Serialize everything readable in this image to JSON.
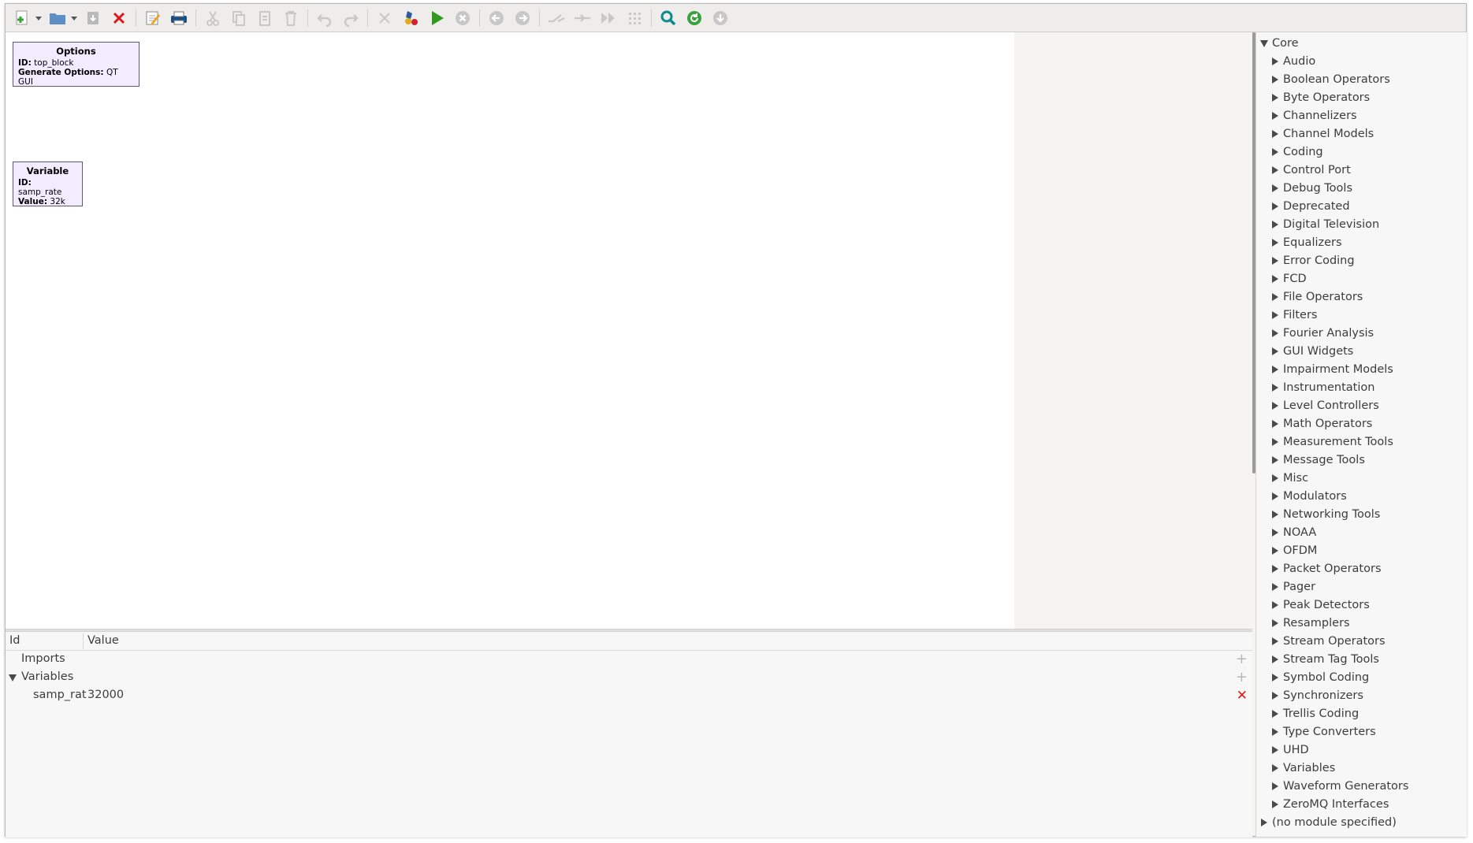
{
  "toolbar": {
    "buttons": [
      {
        "name": "new-button",
        "icon": "new-document-icon"
      },
      {
        "name": "new-dropdown",
        "icon": "chevron-down-icon"
      },
      {
        "name": "open-button",
        "icon": "folder-icon"
      },
      {
        "name": "open-dropdown",
        "icon": "chevron-down-icon"
      },
      {
        "name": "save-button",
        "icon": "save-icon"
      },
      {
        "name": "close-button",
        "icon": "close-icon"
      },
      {
        "name": "properties-button",
        "icon": "edit-icon"
      },
      {
        "name": "print-button",
        "icon": "print-icon"
      },
      {
        "name": "cut-button",
        "icon": "cut-icon"
      },
      {
        "name": "copy-button",
        "icon": "copy-icon"
      },
      {
        "name": "paste-button",
        "icon": "paste-icon"
      },
      {
        "name": "delete-button",
        "icon": "trash-icon"
      },
      {
        "name": "undo-button",
        "icon": "undo-icon"
      },
      {
        "name": "redo-button",
        "icon": "redo-icon"
      },
      {
        "name": "kill-button",
        "icon": "x-icon"
      },
      {
        "name": "generate-button",
        "icon": "generate-icon"
      },
      {
        "name": "execute-button",
        "icon": "play-icon"
      },
      {
        "name": "stop-button",
        "icon": "stop-icon"
      },
      {
        "name": "rotate-ccw-button",
        "icon": "arrow-left-icon"
      },
      {
        "name": "rotate-cw-button",
        "icon": "arrow-right-icon"
      },
      {
        "name": "enable-button",
        "icon": "enable-icon"
      },
      {
        "name": "disable-button",
        "icon": "disable-icon"
      },
      {
        "name": "bypass-button",
        "icon": "bypass-icon"
      },
      {
        "name": "grid-button",
        "icon": "grid-icon"
      },
      {
        "name": "find-button",
        "icon": "search-icon"
      },
      {
        "name": "reload-button",
        "icon": "refresh-icon"
      },
      {
        "name": "download-button",
        "icon": "download-icon"
      }
    ]
  },
  "blocks": {
    "options": {
      "title": "Options",
      "id_label": "ID:",
      "id_value": "top_block",
      "gen_label": "Generate Options:",
      "gen_value": "QT GUI"
    },
    "variable": {
      "title": "Variable",
      "id_label": "ID:",
      "id_value": "samp_rate",
      "value_label": "Value:",
      "value_value": "32k"
    }
  },
  "variables_panel": {
    "col_id": "Id",
    "col_value": "Value",
    "imports_label": "Imports",
    "variables_label": "Variables",
    "var_id": "samp_rat",
    "var_value": "32000",
    "add_glyph": "+",
    "delete_glyph": "✕"
  },
  "library": {
    "root": "Core",
    "categories": [
      "Audio",
      "Boolean Operators",
      "Byte Operators",
      "Channelizers",
      "Channel Models",
      "Coding",
      "Control Port",
      "Debug Tools",
      "Deprecated",
      "Digital Television",
      "Equalizers",
      "Error Coding",
      "FCD",
      "File Operators",
      "Filters",
      "Fourier Analysis",
      "GUI Widgets",
      "Impairment Models",
      "Instrumentation",
      "Level Controllers",
      "Math Operators",
      "Measurement Tools",
      "Message Tools",
      "Misc",
      "Modulators",
      "Networking Tools",
      "NOAA",
      "OFDM",
      "Packet Operators",
      "Pager",
      "Peak Detectors",
      "Resamplers",
      "Stream Operators",
      "Stream Tag Tools",
      "Symbol Coding",
      "Synchronizers",
      "Trellis Coding",
      "Type Converters",
      "UHD",
      "Variables",
      "Waveform Generators",
      "ZeroMQ Interfaces"
    ],
    "extra": "(no module specified)"
  },
  "colors": {
    "block_fill": "#f1ecff",
    "accent_green": "#2e9b1e",
    "delete_red": "#e0161b",
    "find_teal": "#0f8a8a"
  }
}
